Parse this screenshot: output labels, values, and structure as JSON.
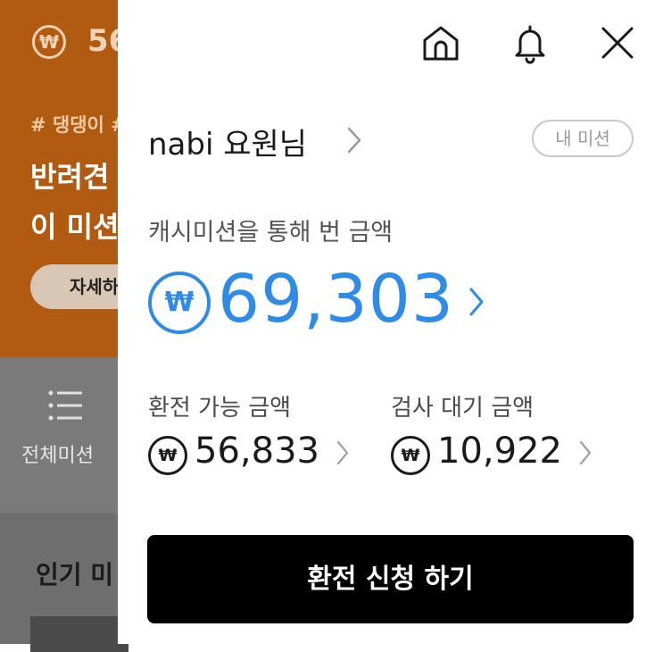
{
  "background": {
    "currency_symbol": "₩",
    "amount_partial": "56",
    "tags_partial": "# 댕댕이 #",
    "title_lines_partial": "반려견\n이 미션",
    "detail_button_partial": "자세하",
    "menu_label_partial": "전체미션",
    "popular_partial": "인기 미"
  },
  "header": {
    "home_icon": "home-icon",
    "bell_icon": "bell-icon",
    "close_icon": "close-icon"
  },
  "user": {
    "name": "nabi 요원님",
    "my_mission_label": "내 미션"
  },
  "earned": {
    "label": "캐시미션을 통해 번 금액",
    "currency_symbol": "₩",
    "amount": "69,303",
    "accent_color": "#2f8be6"
  },
  "stats": [
    {
      "label": "환전 가능 금액",
      "currency_symbol": "₩",
      "value": "56,833"
    },
    {
      "label": "검사 대기 금액",
      "currency_symbol": "₩",
      "value": "10,922"
    }
  ],
  "apply_button": {
    "label": "환전 신청 하기"
  }
}
